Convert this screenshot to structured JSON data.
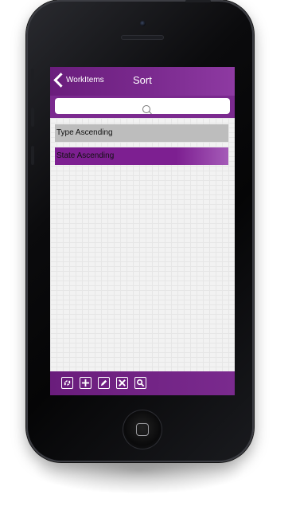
{
  "navbar": {
    "back_label": "WorkItems",
    "title": "Sort"
  },
  "search": {
    "placeholder": ""
  },
  "sort_options": [
    {
      "label": "Type Ascending"
    },
    {
      "label": "State Ascending"
    }
  ],
  "toolbar": {
    "buttons": [
      {
        "icon": "refresh-icon"
      },
      {
        "icon": "add-icon"
      },
      {
        "icon": "edit-icon"
      },
      {
        "icon": "delete-icon"
      },
      {
        "icon": "search-icon"
      }
    ]
  },
  "colors": {
    "accent_purple": "#7b2a8f",
    "selected_row": "#7d1f91",
    "unselected_row": "#bdbdbd"
  }
}
